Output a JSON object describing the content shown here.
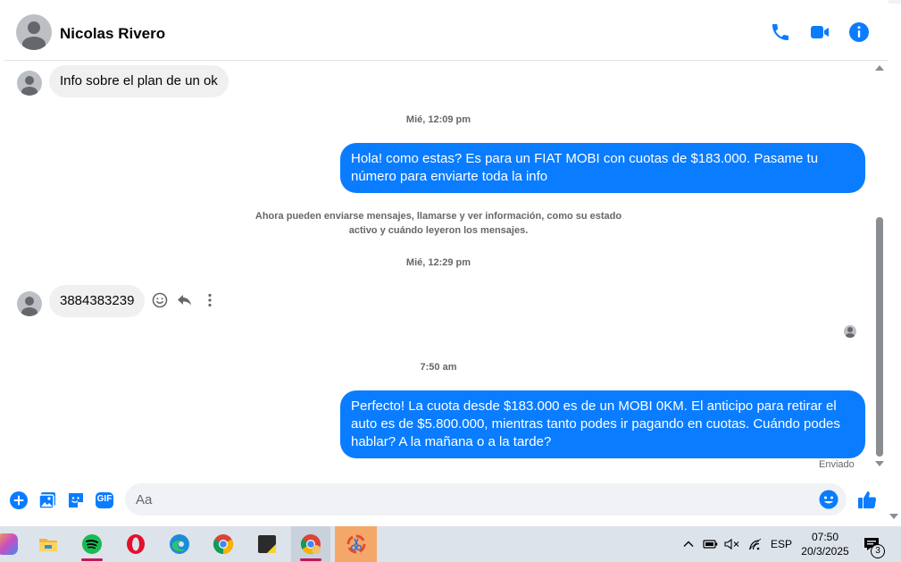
{
  "header": {
    "contact_name": "Nicolas Rivero",
    "icons": [
      "phone-icon",
      "video-icon",
      "info-icon"
    ]
  },
  "thread": {
    "messages": [
      {
        "direction": "in",
        "text": "Info sobre el plan de un ok"
      },
      {
        "type": "timestamp",
        "text": "Mié, 12:09 pm"
      },
      {
        "direction": "out",
        "text": "Hola! como estas? Es para un FIAT MOBI con cuotas de $183.000. Pasame tu número para enviarte toda la info"
      },
      {
        "type": "system",
        "line1": "Ahora pueden enviarse mensajes, llamarse y ver información, como su estado",
        "line2": "activo y cuándo leyeron los mensajes."
      },
      {
        "type": "timestamp",
        "text": "Mié, 12:29 pm"
      },
      {
        "direction": "in",
        "text": "3884383239"
      },
      {
        "type": "timestamp",
        "text": "7:50 am"
      },
      {
        "direction": "out",
        "text": "Perfecto! La cuota desde $183.000 es de un MOBI 0KM. El anticipo para retirar el auto es de $5.800.000, mientras tanto podes ir pagando en cuotas. Cuándo podes hablar? A la mañana o a la tarde?"
      }
    ],
    "delivery_status": "Enviado"
  },
  "composer": {
    "placeholder": "Aa",
    "icons": [
      "plus-icon",
      "image-icon",
      "sticker-icon",
      "gif-icon",
      "emoji-icon",
      "like-icon"
    ],
    "gif_label": "GIF"
  },
  "taskbar": {
    "apps": [
      "copilot-icon",
      "file-explorer-icon",
      "spotify-icon",
      "opera-icon",
      "edge-icon",
      "chrome-icon",
      "sticky-notes-icon",
      "chrome-profile-icon",
      "snipping-tool-icon"
    ],
    "language": "ESP",
    "time": "07:50",
    "date": "20/3/2025",
    "notification_count": "3"
  },
  "colors": {
    "accent": "#0a7cff",
    "incoming_bubble": "#f0f0f0"
  }
}
